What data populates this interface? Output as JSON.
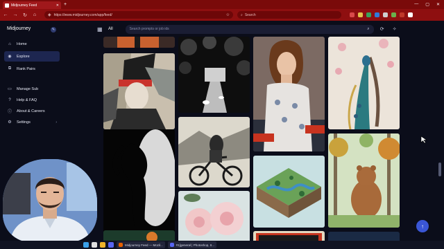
{
  "browser": {
    "tab_title": "Midjourney Feed",
    "url": "https://www.midjourney.com/app/feed/",
    "search_placeholder": "Search"
  },
  "app": {
    "brand": "Midjourney",
    "nav_items": [
      {
        "label": "Home",
        "icon": "house-icon",
        "active": false
      },
      {
        "label": "Explore",
        "icon": "compass-icon",
        "active": true
      },
      {
        "label": "Rank Pairs",
        "icon": "pairs-icon",
        "active": false
      },
      {
        "label": "Manage Sub",
        "icon": "card-icon",
        "active": false
      },
      {
        "label": "Help & FAQ",
        "icon": "help-icon",
        "active": false
      },
      {
        "label": "About & Careers",
        "icon": "info-icon",
        "active": false
      },
      {
        "label": "Settings",
        "icon": "gear-icon",
        "active": false
      }
    ],
    "filter_label": "All",
    "search_placeholder": "Search prompts or job ids"
  },
  "taskbar": {
    "windows": [
      {
        "label": "Midjourney Feed — Mozil..."
      },
      {
        "label": "#1[general | Photoshop, II..."
      }
    ]
  },
  "colors": {
    "chrome": "#8e0f10",
    "sidebar_active": "#1d2650",
    "accent": "#3a56d6"
  }
}
